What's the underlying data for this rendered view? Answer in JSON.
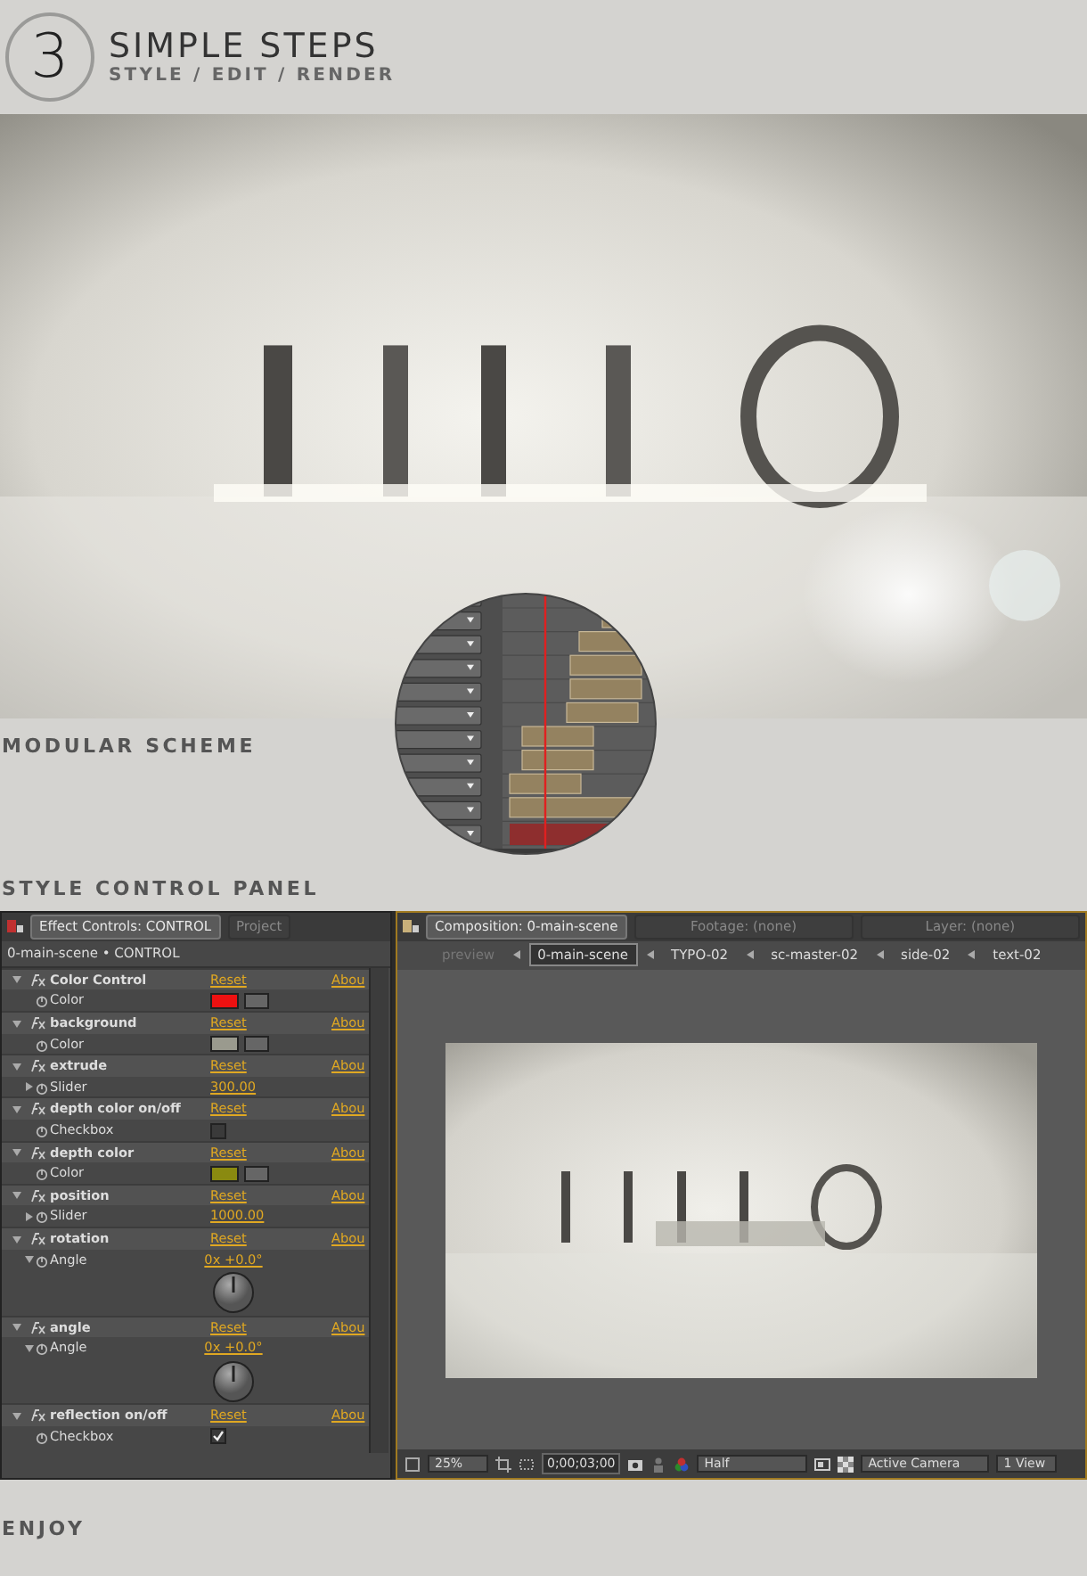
{
  "header": {
    "number": "3",
    "title": "SIMPLE STEPS",
    "subtitle": "STYLE / EDIT / RENDER"
  },
  "modular_label": "MODULAR SCHEME",
  "panel_label": "STYLE CONTROL PANEL",
  "effect_controls": {
    "tab": "Effect Controls: CONTROL",
    "other_tab": "Project",
    "breadcrumb": "0-main-scene • CONTROL",
    "effects": [
      {
        "name": "Color Control",
        "expanded": true,
        "reset": "Reset",
        "about": "Abou",
        "params": [
          {
            "kind": "color",
            "name": "Color",
            "color": "#ee1111"
          }
        ]
      },
      {
        "name": "background",
        "expanded": true,
        "reset": "Reset",
        "about": "Abou",
        "params": [
          {
            "kind": "color",
            "name": "Color",
            "color": "#9a9a8e"
          }
        ]
      },
      {
        "name": "extrude",
        "expanded": true,
        "reset": "Reset",
        "about": "Abou",
        "params": [
          {
            "kind": "slider",
            "name": "Slider",
            "value": "300.00",
            "expanded": false
          }
        ]
      },
      {
        "name": "depth color on/off",
        "expanded": true,
        "reset": "Reset",
        "about": "Abou",
        "params": [
          {
            "kind": "checkbox",
            "name": "Checkbox",
            "checked": false
          }
        ]
      },
      {
        "name": "depth color",
        "expanded": true,
        "reset": "Reset",
        "about": "Abou",
        "params": [
          {
            "kind": "color",
            "name": "Color",
            "color": "#8a8a10"
          }
        ]
      },
      {
        "name": "position",
        "expanded": true,
        "reset": "Reset",
        "about": "Abou",
        "params": [
          {
            "kind": "slider",
            "name": "Slider",
            "value": "1000.00",
            "expanded": false
          }
        ]
      },
      {
        "name": "rotation",
        "expanded": true,
        "reset": "Reset",
        "about": "Abou",
        "params": [
          {
            "kind": "angle",
            "name": "Angle",
            "value": "0x +0.0°",
            "expanded": true
          }
        ]
      },
      {
        "name": "angle",
        "expanded": true,
        "reset": "Reset",
        "about": "Abou",
        "params": [
          {
            "kind": "angle",
            "name": "Angle",
            "value": "0x +0.0°",
            "expanded": true
          }
        ]
      },
      {
        "name": "reflection on/off",
        "expanded": true,
        "reset": "Reset",
        "about": "Abou",
        "params": [
          {
            "kind": "checkbox",
            "name": "Checkbox",
            "checked": true
          }
        ]
      }
    ]
  },
  "composition": {
    "tabs": [
      {
        "label": "Composition: 0-main-scene",
        "selected": true
      },
      {
        "label": "Footage: (none)",
        "selected": false
      },
      {
        "label": "Layer: (none)",
        "selected": false
      }
    ],
    "breadcrumbs": [
      {
        "label": "preview",
        "selected": false,
        "disabled": true
      },
      {
        "label": "0-main-scene",
        "selected": true,
        "disabled": false
      },
      {
        "label": "TYPO-02",
        "selected": false,
        "disabled": false
      },
      {
        "label": "sc-master-02",
        "selected": false,
        "disabled": false
      },
      {
        "label": "side-02",
        "selected": false,
        "disabled": false
      },
      {
        "label": "text-02",
        "selected": false,
        "disabled": false
      }
    ],
    "toolbar": {
      "zoom": "25%",
      "time": "0;00;03;00",
      "resolution": "Half",
      "camera": "Active Camera",
      "view": "1 View"
    }
  },
  "footer_label": "ENJOY"
}
